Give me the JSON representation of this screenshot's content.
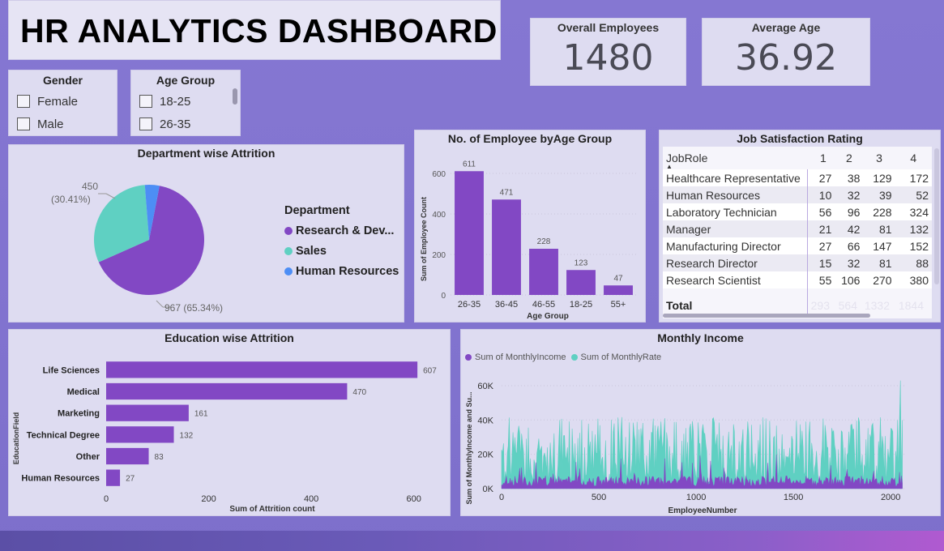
{
  "title": "HR ANALYTICS DASHBOARD",
  "kpis": {
    "overall_employees": {
      "label": "Overall Employees",
      "value": "1480"
    },
    "average_age": {
      "label": "Average Age",
      "value": "36.92"
    }
  },
  "slicers": {
    "gender": {
      "title": "Gender",
      "options": [
        "Female",
        "Male"
      ]
    },
    "age_group": {
      "title": "Age Group",
      "options": [
        "18-25",
        "26-35"
      ]
    }
  },
  "department_attrition": {
    "title": "Department wise Attrition",
    "legend_title": "Department",
    "slices": [
      {
        "name": "Research & Dev...",
        "value": 967,
        "label": "967 (65.34%)",
        "color": "#8248c4"
      },
      {
        "name": "Sales",
        "value": 450,
        "label_value": "450",
        "label_pct": "(30.41%)",
        "color": "#5fd0c2"
      },
      {
        "name": "Human Resources",
        "value": 63,
        "color": "#4d8ef5"
      }
    ]
  },
  "age_group_chart": {
    "title": "No. of Employee byAge Group",
    "xlabel": "Age Group",
    "ylabel": "Sum of Employee Count"
  },
  "job_satisfaction": {
    "title": "Job Satisfaction Rating",
    "columns": [
      "JobRole",
      "1",
      "2",
      "3",
      "4"
    ],
    "rows": [
      [
        "Healthcare Representative",
        "27",
        "38",
        "129",
        "172"
      ],
      [
        "Human Resources",
        "10",
        "32",
        "39",
        "52"
      ],
      [
        "Laboratory Technician",
        "56",
        "96",
        "228",
        "324"
      ],
      [
        "Manager",
        "21",
        "42",
        "81",
        "132"
      ],
      [
        "Manufacturing Director",
        "27",
        "66",
        "147",
        "152"
      ],
      [
        "Research Director",
        "15",
        "32",
        "81",
        "88"
      ],
      [
        "Research Scientist",
        "55",
        "106",
        "270",
        "380"
      ]
    ],
    "total": [
      "Total",
      "293",
      "564",
      "1332",
      "1844"
    ]
  },
  "education_chart": {
    "title": "Education wise Attrition",
    "xlabel": "Sum of Attrition count",
    "ylabel": "EducationField"
  },
  "monthly_income_chart": {
    "title": "Monthly Income",
    "xlabel": "EmployeeNumber",
    "ylabel": "Sum of MonthlyIncome and Su...",
    "legend": [
      "Sum of MonthlyIncome",
      "Sum of MonthlyRate"
    ]
  },
  "chart_data": [
    {
      "type": "pie",
      "title": "Department wise Attrition",
      "categories": [
        "Research & Dev...",
        "Sales",
        "Human Resources"
      ],
      "values": [
        967,
        450,
        63
      ],
      "legend": "right"
    },
    {
      "type": "bar",
      "title": "No. of Employee byAge Group",
      "categories": [
        "26-35",
        "36-45",
        "46-55",
        "18-25",
        "55+"
      ],
      "values": [
        611,
        471,
        228,
        123,
        47
      ],
      "xlabel": "Age Group",
      "ylabel": "Sum of Employee Count",
      "yticks": [
        0,
        200,
        400,
        600
      ],
      "ylim": [
        0,
        660
      ],
      "color": "#8248c4"
    },
    {
      "type": "bar",
      "orientation": "horizontal",
      "title": "Education wise Attrition",
      "categories": [
        "Life Sciences",
        "Medical",
        "Marketing",
        "Technical Degree",
        "Other",
        "Human Resources"
      ],
      "values": [
        607,
        470,
        161,
        132,
        83,
        27
      ],
      "xlabel": "Sum of Attrition count",
      "ylabel": "EducationField",
      "xticks": [
        0,
        200,
        400,
        600
      ],
      "xlim": [
        0,
        640
      ],
      "color": "#8248c4"
    },
    {
      "type": "area",
      "title": "Monthly Income",
      "xlabel": "EmployeeNumber",
      "ylabel": "Sum of MonthlyIncome and Su...",
      "xticks": [
        0,
        500,
        1000,
        1500,
        2000
      ],
      "yticks": [
        "0K",
        "20K",
        "40K",
        "60K"
      ],
      "xlim": [
        0,
        2070
      ],
      "ylim": [
        0,
        68000
      ],
      "series": [
        {
          "name": "Sum of MonthlyIncome",
          "color": "#8248c4",
          "approx_range": [
            1000,
            20000
          ]
        },
        {
          "name": "Sum of MonthlyRate",
          "color": "#5fd0c2",
          "approx_range": [
            2000,
            63000
          ]
        }
      ]
    }
  ]
}
